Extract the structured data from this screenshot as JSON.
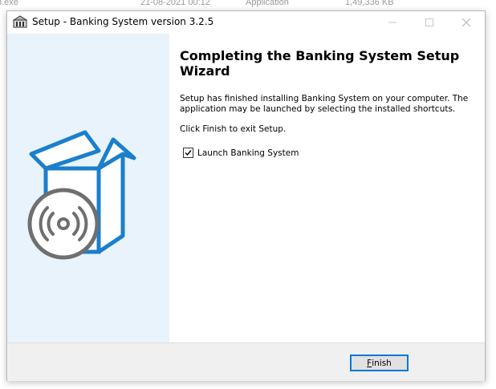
{
  "background_row": {
    "filename": "n.exe",
    "date": "21-08-2021 00:12",
    "type": "Application",
    "size": "1,49,336 KB"
  },
  "window": {
    "title": "Setup - Banking System version 3.2.5",
    "minimize_icon": "minimize-icon",
    "maximize_icon": "maximize-icon",
    "close_icon": "close-icon"
  },
  "wizard": {
    "heading": "Completing the Banking System Setup Wizard",
    "message": "Setup has finished installing Banking System on your computer. The application may be launched by selecting the installed shortcuts.",
    "finish_prompt": "Click Finish to exit Setup.",
    "launch_checkbox": {
      "label": "Launch Banking System",
      "checked": true
    },
    "illustration_icon": "software-box-cd-icon"
  },
  "footer": {
    "finish_label_first": "F",
    "finish_label_rest": "inish"
  },
  "colors": {
    "sidebar_bg": "#e8f3fb",
    "box_blue": "#1b7fcc",
    "disc_gray": "#6f6f6f",
    "button_border": "#0078d7"
  }
}
